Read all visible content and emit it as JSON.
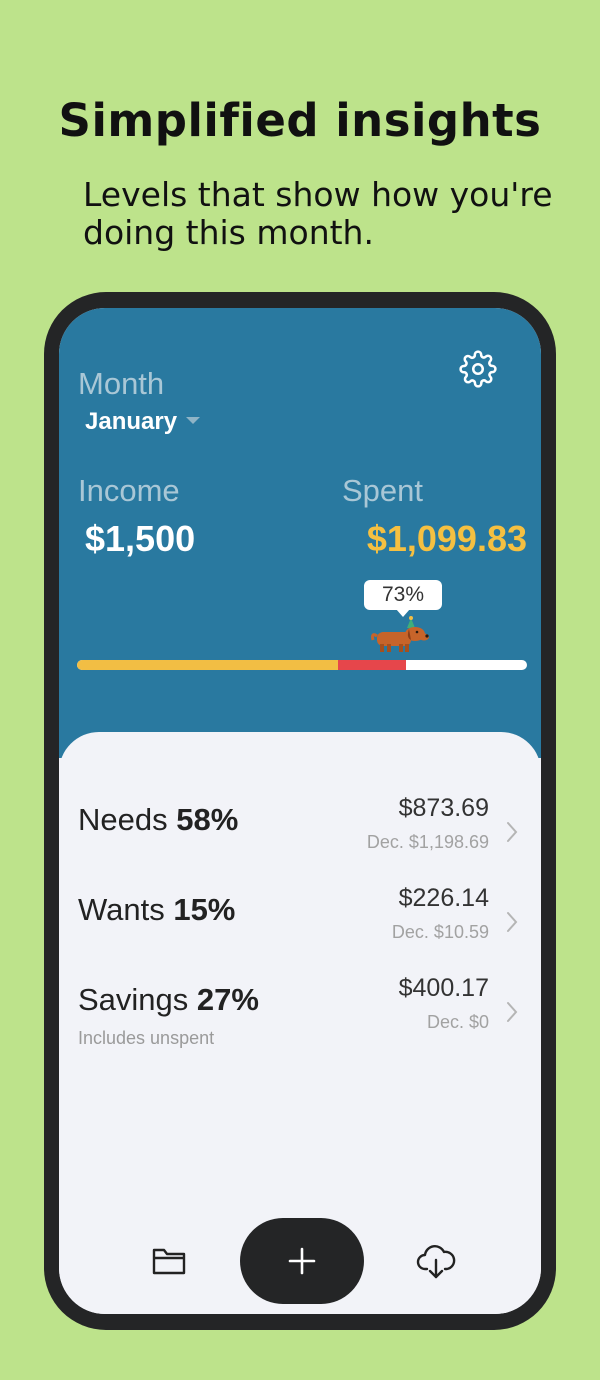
{
  "promo": {
    "headline": "Simplified insights",
    "subline": "Levels that show how you're doing this month."
  },
  "header": {
    "month_label": "Month",
    "month_value": "January",
    "income_label": "Income",
    "income_value": "$1,500",
    "spent_label": "Spent",
    "spent_value": "$1,099.83",
    "spent_percent_label": "73%",
    "progress": {
      "needs_fraction": 0.58,
      "wants_fraction": 0.15
    }
  },
  "categories": [
    {
      "name": "Needs",
      "percent": "58%",
      "amount": "$873.69",
      "previous": "Dec. $1,198.69",
      "note": ""
    },
    {
      "name": "Wants",
      "percent": "15%",
      "amount": "$226.14",
      "previous": "Dec. $10.59",
      "note": ""
    },
    {
      "name": "Savings",
      "percent": "27%",
      "amount": "$400.17",
      "previous": "Dec. $0",
      "note": "Includes unspent"
    }
  ],
  "nav": {
    "left_icon": "folder-icon",
    "center_icon": "plus-icon",
    "right_icon": "cloud-download-icon"
  },
  "colors": {
    "background": "#bde38b",
    "header": "#2979a0",
    "spent_accent": "#f5c041",
    "needs_bar": "#f2be44",
    "wants_bar": "#e6464b"
  }
}
